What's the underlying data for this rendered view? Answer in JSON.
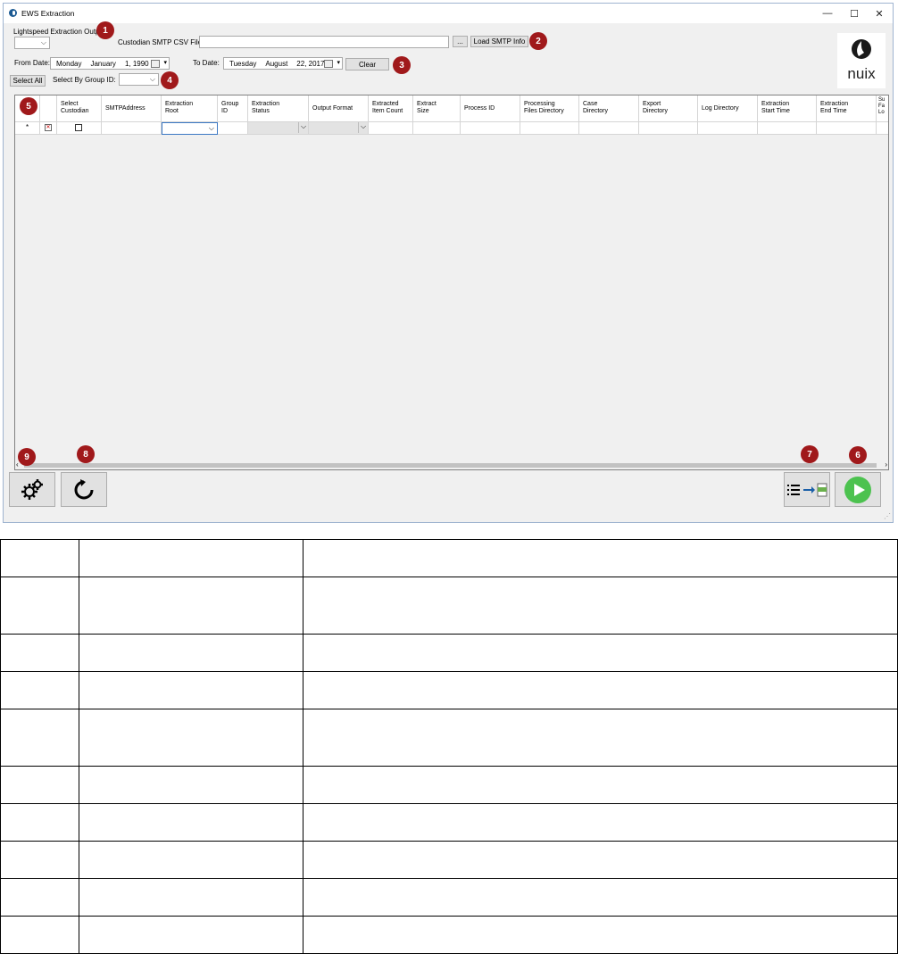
{
  "window": {
    "title": "EWS Extraction",
    "minimize": "—",
    "maximize": "☐",
    "close": "✕"
  },
  "form": {
    "lightspeed_label": "Lightspeed Extraction Output",
    "custodian_csv_label": "Custodian SMTP CSV File:",
    "browse_label": "...",
    "load_smtp_label": "Load SMTP Info",
    "from_date_label": "From Date:",
    "from_date": {
      "day": "Monday",
      "month": "January",
      "date": "1, 1990"
    },
    "to_date_label": "To Date:",
    "to_date": {
      "day": "Tuesday",
      "month": "August",
      "date": "22, 2017"
    },
    "clear_label": "Clear",
    "select_all_label": "Select All",
    "group_id_label": "Select By Group ID:"
  },
  "badges": [
    "1",
    "2",
    "3",
    "4",
    "5",
    "6",
    "7",
    "8",
    "9"
  ],
  "logo": {
    "text": "nuix"
  },
  "grid": {
    "columns": [
      "",
      "",
      "Select\nCustodian",
      "SMTPAddress",
      "Extraction\nRoot",
      "Group\nID",
      "Extraction\nStatus",
      "Output Format",
      "Extracted\nItem Count",
      "Extract\nSize",
      "Process ID",
      "Processing\nFiles Directory",
      "Case\nDirectory",
      "Export\nDirectory",
      "Log Directory",
      "Extraction\nStart Time",
      "Extraction\nEnd Time",
      "Su\nFa\nLo"
    ],
    "new_row_marker": "*",
    "delete_mark": "✕"
  },
  "footer_buttons": {
    "settings": "gears-icon",
    "refresh": "refresh-icon",
    "export": "list-to-csv-icon",
    "run": "play-icon"
  },
  "bottom_table": {
    "rows": [
      [
        "",
        "",
        ""
      ],
      [
        "",
        "",
        ""
      ],
      [
        "",
        "",
        ""
      ],
      [
        "",
        "",
        ""
      ],
      [
        "",
        "",
        ""
      ],
      [
        "",
        "",
        ""
      ],
      [
        "",
        "",
        ""
      ],
      [
        "",
        "",
        ""
      ],
      [
        "",
        "",
        ""
      ],
      [
        "",
        "",
        ""
      ]
    ]
  },
  "colors": {
    "badge": "#a0191b",
    "run": "#4cc24f",
    "window_border": "#9fb4d0"
  }
}
